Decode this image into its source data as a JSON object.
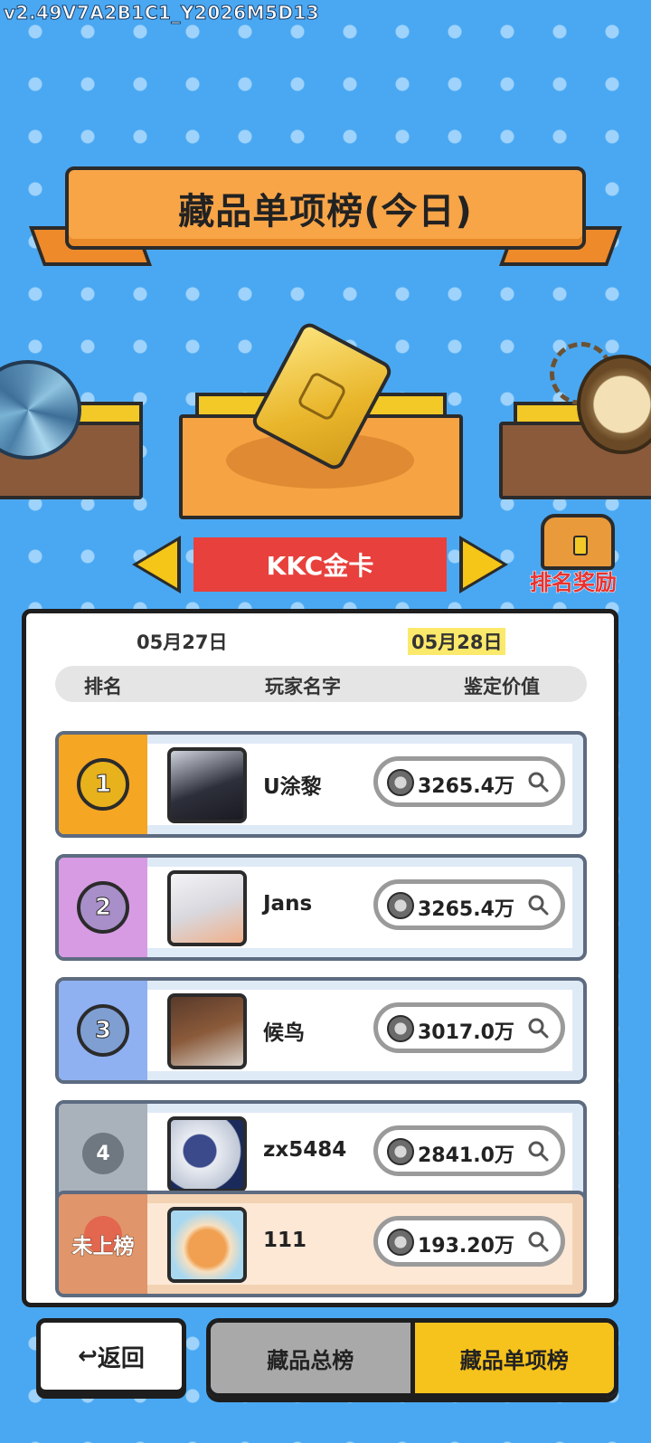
{
  "version": "v2.49V7A2B1C1_Y2026M5D13",
  "title": "藏品单项榜(今日)",
  "item": {
    "name": "KKC金卡",
    "card_text": "KKC"
  },
  "reward_label": "排名奖励",
  "dates": [
    "05月27日",
    "05月28日"
  ],
  "selected_date_index": 1,
  "columns": {
    "rank": "排名",
    "name": "玩家名字",
    "value": "鉴定价值"
  },
  "rankings": [
    {
      "rank": "1",
      "name": "U涂黎",
      "value": "3265.4万"
    },
    {
      "rank": "2",
      "name": "Jans",
      "value": "3265.4万"
    },
    {
      "rank": "3",
      "name": "候鸟",
      "value": "3017.0万"
    },
    {
      "rank": "4",
      "name": "zx5484",
      "value": "2841.0万"
    }
  ],
  "my_rank": {
    "label": "未上榜",
    "name": "111",
    "value": "193.20万"
  },
  "buttons": {
    "back": "返回",
    "back_icon": "↩",
    "tab_total": "藏品总榜",
    "tab_single": "藏品单项榜"
  },
  "colors": {
    "rank1": "#f5a623",
    "rank2": "#d79be4",
    "rank3": "#8fb1f2",
    "rank4": "#a9b1bb",
    "active_tab": "#f6c21c",
    "item_name_bg": "#e8403c"
  }
}
